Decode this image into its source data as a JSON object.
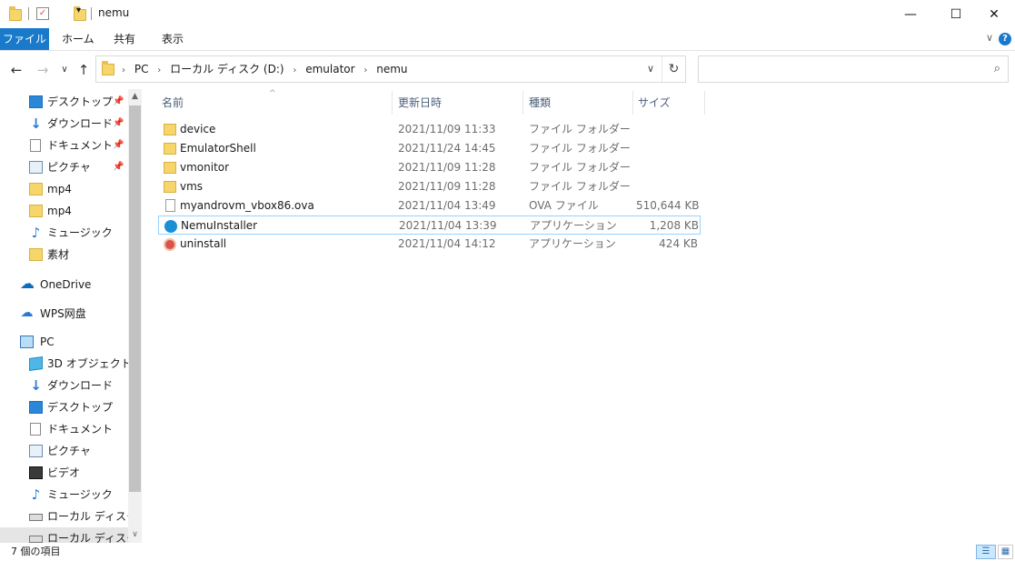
{
  "window": {
    "title": "nemu",
    "minimize": "—",
    "maximize": "☐",
    "close": "✕"
  },
  "ribbon": {
    "tabs": [
      "ファイル",
      "ホーム",
      "共有",
      "表示"
    ],
    "expand": "∨",
    "help": "?"
  },
  "nav": {
    "back": "←",
    "forward": "→",
    "recent": "∨",
    "up": "↑",
    "crumbs": [
      "PC",
      "ローカル ディスク (D:)",
      "emulator",
      "nemu"
    ],
    "crumb_sep": "›",
    "dropdown": "∨",
    "refresh": "↻",
    "search_placeholder": "",
    "search_icon": "⌕"
  },
  "sidebar": {
    "items": [
      {
        "label": "デスクトップ",
        "icon": "desktop-icon",
        "pinned": true
      },
      {
        "label": "ダウンロード",
        "icon": "download-icon",
        "pinned": true
      },
      {
        "label": "ドキュメント",
        "icon": "documents-icon",
        "pinned": true
      },
      {
        "label": "ピクチャ",
        "icon": "pictures-icon",
        "pinned": true
      },
      {
        "label": "mp4",
        "icon": "folder-icon"
      },
      {
        "label": "mp4",
        "icon": "folder-icon"
      },
      {
        "label": "ミュージック",
        "icon": "music-icon"
      },
      {
        "label": "素材",
        "icon": "folder-icon"
      },
      {
        "label": "OneDrive",
        "icon": "onedrive-icon"
      },
      {
        "label": "WPS网盘",
        "icon": "wps-cloud-icon"
      },
      {
        "label": "PC",
        "icon": "pc-icon"
      },
      {
        "label": "3D オブジェクト",
        "icon": "3d-objects-icon"
      },
      {
        "label": "ダウンロード",
        "icon": "download-icon"
      },
      {
        "label": "デスクトップ",
        "icon": "desktop-icon"
      },
      {
        "label": "ドキュメント",
        "icon": "documents-icon"
      },
      {
        "label": "ピクチャ",
        "icon": "pictures-icon"
      },
      {
        "label": "ビデオ",
        "icon": "videos-icon"
      },
      {
        "label": "ミュージック",
        "icon": "music-icon"
      },
      {
        "label": "ローカル ディスク (C",
        "icon": "drive-icon"
      },
      {
        "label": "ローカル ディスク (D",
        "icon": "drive-icon"
      }
    ],
    "pin_glyph": "📌",
    "scroll_up": "▲",
    "scroll_down": "∨"
  },
  "columns": {
    "name": "名前",
    "date": "更新日時",
    "type": "種類",
    "size": "サイズ",
    "sort_indicator": "^"
  },
  "files": [
    {
      "name": "device",
      "date": "2021/11/09 11:33",
      "type": "ファイル フォルダー",
      "size": "",
      "icon": "folder-icon"
    },
    {
      "name": "EmulatorShell",
      "date": "2021/11/24 14:45",
      "type": "ファイル フォルダー",
      "size": "",
      "icon": "folder-icon"
    },
    {
      "name": "vmonitor",
      "date": "2021/11/09 11:28",
      "type": "ファイル フォルダー",
      "size": "",
      "icon": "folder-icon"
    },
    {
      "name": "vms",
      "date": "2021/11/09 11:28",
      "type": "ファイル フォルダー",
      "size": "",
      "icon": "folder-icon"
    },
    {
      "name": "myandrovm_vbox86.ova",
      "date": "2021/11/04 13:49",
      "type": "OVA ファイル",
      "size": "510,644 KB",
      "icon": "file-icon"
    },
    {
      "name": "NemuInstaller",
      "date": "2021/11/04 13:39",
      "type": "アプリケーション",
      "size": "1,208 KB",
      "icon": "nemu-app-icon"
    },
    {
      "name": "uninstall",
      "date": "2021/11/04 14:12",
      "type": "アプリケーション",
      "size": "424 KB",
      "icon": "uninstall-app-icon"
    }
  ],
  "status": {
    "count": "7 個の項目",
    "details_view": "☰",
    "large_icons_view": "▦"
  }
}
